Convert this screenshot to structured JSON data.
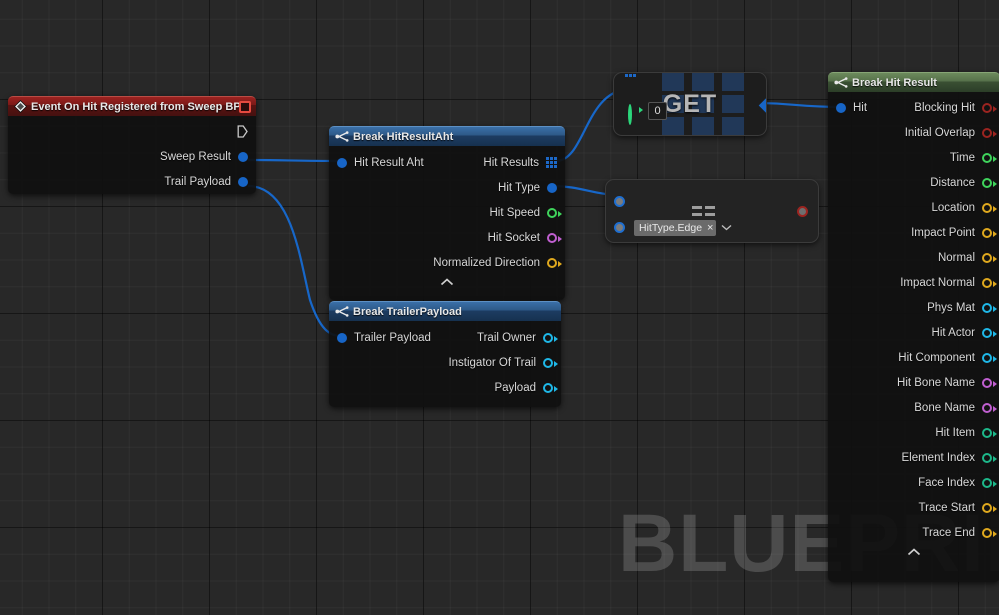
{
  "canvas": {
    "watermark": "BLUEPRINT",
    "background_color": "#282828",
    "grid_minor_color": "#2e2e2e",
    "grid_major_color": "#141414"
  },
  "nodes": {
    "event_node": {
      "title": "Event On Hit Registered from Sweep BP",
      "header_color": "#7b1a18",
      "icon": "event-diamond-icon",
      "close_button": "close-square-button",
      "exec_out": "exec-output-pin",
      "outputs": [
        {
          "label": "Sweep Result",
          "pin": "struct",
          "color": "#1765c7"
        },
        {
          "label": "Trail Payload",
          "pin": "struct",
          "color": "#1765c7"
        }
      ]
    },
    "break_hitresultaht": {
      "title": "Break HitResultAht",
      "header_color": "#2d5886",
      "icon": "break-struct-icon",
      "inputs": [
        {
          "label": "Hit Result Aht",
          "pin": "struct",
          "color": "#1765c7"
        }
      ],
      "outputs": [
        {
          "label": "Hit Results",
          "pin": "array",
          "color": "#1c68c8"
        },
        {
          "label": "Hit Type",
          "pin": "struct",
          "color": "#1765c7"
        },
        {
          "label": "Hit Speed",
          "pin": "float",
          "color": "#3fd45c"
        },
        {
          "label": "Hit Socket",
          "pin": "name",
          "color": "#c05fd0"
        },
        {
          "label": "Normalized Direction",
          "pin": "vector",
          "color": "#e0a91e"
        }
      ],
      "collapse": "collapse-chevron-icon"
    },
    "break_trailerpayload": {
      "title": "Break TrailerPayload",
      "header_color": "#2d5886",
      "icon": "break-struct-icon",
      "inputs": [
        {
          "label": "Trailer Payload",
          "pin": "struct",
          "color": "#1765c7"
        }
      ],
      "outputs": [
        {
          "label": "Trail Owner",
          "pin": "object",
          "color": "#1fb8e8"
        },
        {
          "label": "Instigator Of Trail",
          "pin": "object",
          "color": "#1fb8e8"
        },
        {
          "label": "Payload",
          "pin": "object",
          "color": "#1fb8e8"
        }
      ]
    },
    "get_node": {
      "label": "GET",
      "index_value": "0",
      "array_input_pin": "array-input-pin",
      "index_input_pin": "integer-input-pin",
      "output_pin": "struct-output-pin"
    },
    "equals_node": {
      "symbol": "==",
      "enum_value": "HitType.Edge",
      "clear_button": "×",
      "dropdown_caret": "⌄",
      "input_a": "wildcard-input-a",
      "input_b": "wildcard-input-b",
      "output": "boolean-output-pin"
    },
    "break_hit_result": {
      "title": "Break Hit Result",
      "header_color": "#55704a",
      "icon": "break-struct-icon",
      "inputs": [
        {
          "label": "Hit",
          "pin": "struct",
          "color": "#1765c7"
        }
      ],
      "outputs": [
        {
          "label": "Blocking Hit",
          "pin": "bool",
          "color": "#9c2420"
        },
        {
          "label": "Initial Overlap",
          "pin": "bool",
          "color": "#9c2420"
        },
        {
          "label": "Time",
          "pin": "float",
          "color": "#3fd45c"
        },
        {
          "label": "Distance",
          "pin": "float",
          "color": "#3fd45c"
        },
        {
          "label": "Location",
          "pin": "vector",
          "color": "#e0a91e"
        },
        {
          "label": "Impact Point",
          "pin": "vector",
          "color": "#e0a91e"
        },
        {
          "label": "Normal",
          "pin": "vector",
          "color": "#e0a91e"
        },
        {
          "label": "Impact Normal",
          "pin": "vector",
          "color": "#e0a91e"
        },
        {
          "label": "Phys Mat",
          "pin": "object",
          "color": "#1fb8e8"
        },
        {
          "label": "Hit Actor",
          "pin": "object",
          "color": "#1fb8e8"
        },
        {
          "label": "Hit Component",
          "pin": "object",
          "color": "#1fb8e8"
        },
        {
          "label": "Hit Bone Name",
          "pin": "name",
          "color": "#c05fd0"
        },
        {
          "label": "Bone Name",
          "pin": "name",
          "color": "#c05fd0"
        },
        {
          "label": "Hit Item",
          "pin": "int",
          "color": "#1db88a"
        },
        {
          "label": "Element Index",
          "pin": "int",
          "color": "#1db88a"
        },
        {
          "label": "Face Index",
          "pin": "int",
          "color": "#1db88a"
        },
        {
          "label": "Trace Start",
          "pin": "vector",
          "color": "#e0a91e"
        },
        {
          "label": "Trace End",
          "pin": "vector",
          "color": "#e0a91e"
        }
      ],
      "collapse": "collapse-chevron-icon"
    }
  },
  "wires": {
    "color": "#1767c9",
    "connections": [
      "event.Sweep Result -> break_hitresultaht.Hit Result Aht",
      "event.Trail Payload -> break_trailerpayload.Trailer Payload",
      "break_hitresultaht.Hit Results -> get_node.array",
      "break_hitresultaht.Hit Type -> equals_node.input_a",
      "get_node.output -> break_hit_result.Hit"
    ]
  }
}
